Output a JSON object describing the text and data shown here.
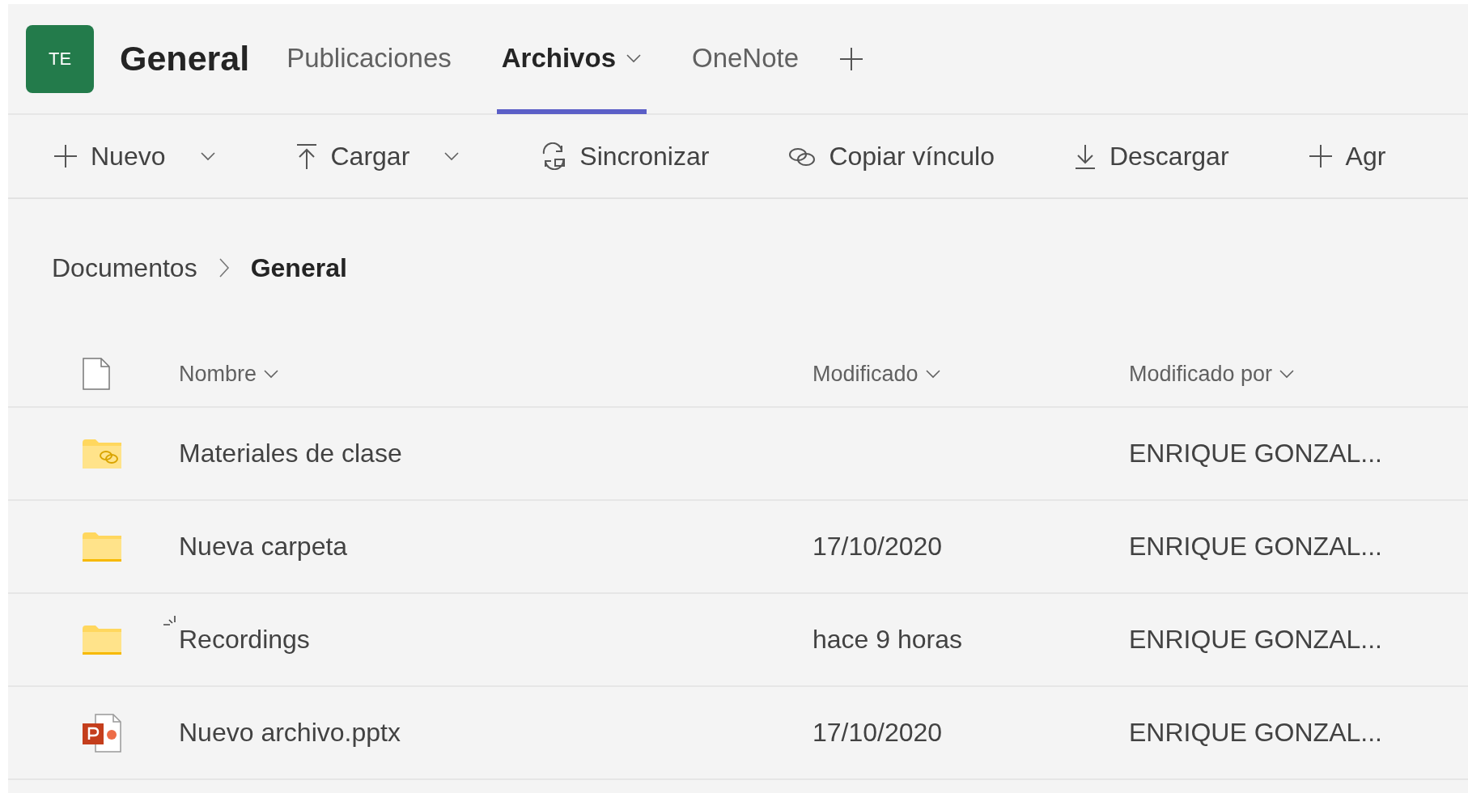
{
  "team": {
    "initials": "TE",
    "channel": "General"
  },
  "tabs": [
    {
      "label": "Publicaciones",
      "selected": false,
      "dropdown": false
    },
    {
      "label": "Archivos",
      "selected": true,
      "dropdown": true
    },
    {
      "label": "OneNote",
      "selected": false,
      "dropdown": false
    }
  ],
  "toolbar": [
    {
      "label": "Nuevo",
      "kind": "plus",
      "dropdown": true
    },
    {
      "label": "Cargar",
      "kind": "upload",
      "dropdown": true
    },
    {
      "label": "Sincronizar",
      "kind": "sync",
      "dropdown": false
    },
    {
      "label": "Copiar vínculo",
      "kind": "link",
      "dropdown": false
    },
    {
      "label": "Descargar",
      "kind": "download",
      "dropdown": false
    },
    {
      "label": "Agr",
      "kind": "plus",
      "dropdown": false
    }
  ],
  "breadcrumb": [
    "Documentos",
    "General"
  ],
  "table": {
    "columns": [
      "Nombre",
      "Modificado",
      "Modificado por"
    ],
    "rows": [
      {
        "kind": "shared-folder",
        "name": "Materiales de clase",
        "modified": "",
        "modified_by": "ENRIQUE GONZAL...",
        "syncing": false
      },
      {
        "kind": "folder",
        "name": "Nueva carpeta",
        "modified": "17/10/2020",
        "modified_by": "ENRIQUE GONZAL...",
        "syncing": false
      },
      {
        "kind": "folder",
        "name": "Recordings",
        "modified": "hace 9 horas",
        "modified_by": "ENRIQUE GONZAL...",
        "syncing": true
      },
      {
        "kind": "pptx",
        "name": "Nuevo archivo.pptx",
        "modified": "17/10/2020",
        "modified_by": "ENRIQUE GONZAL...",
        "syncing": false
      }
    ]
  }
}
